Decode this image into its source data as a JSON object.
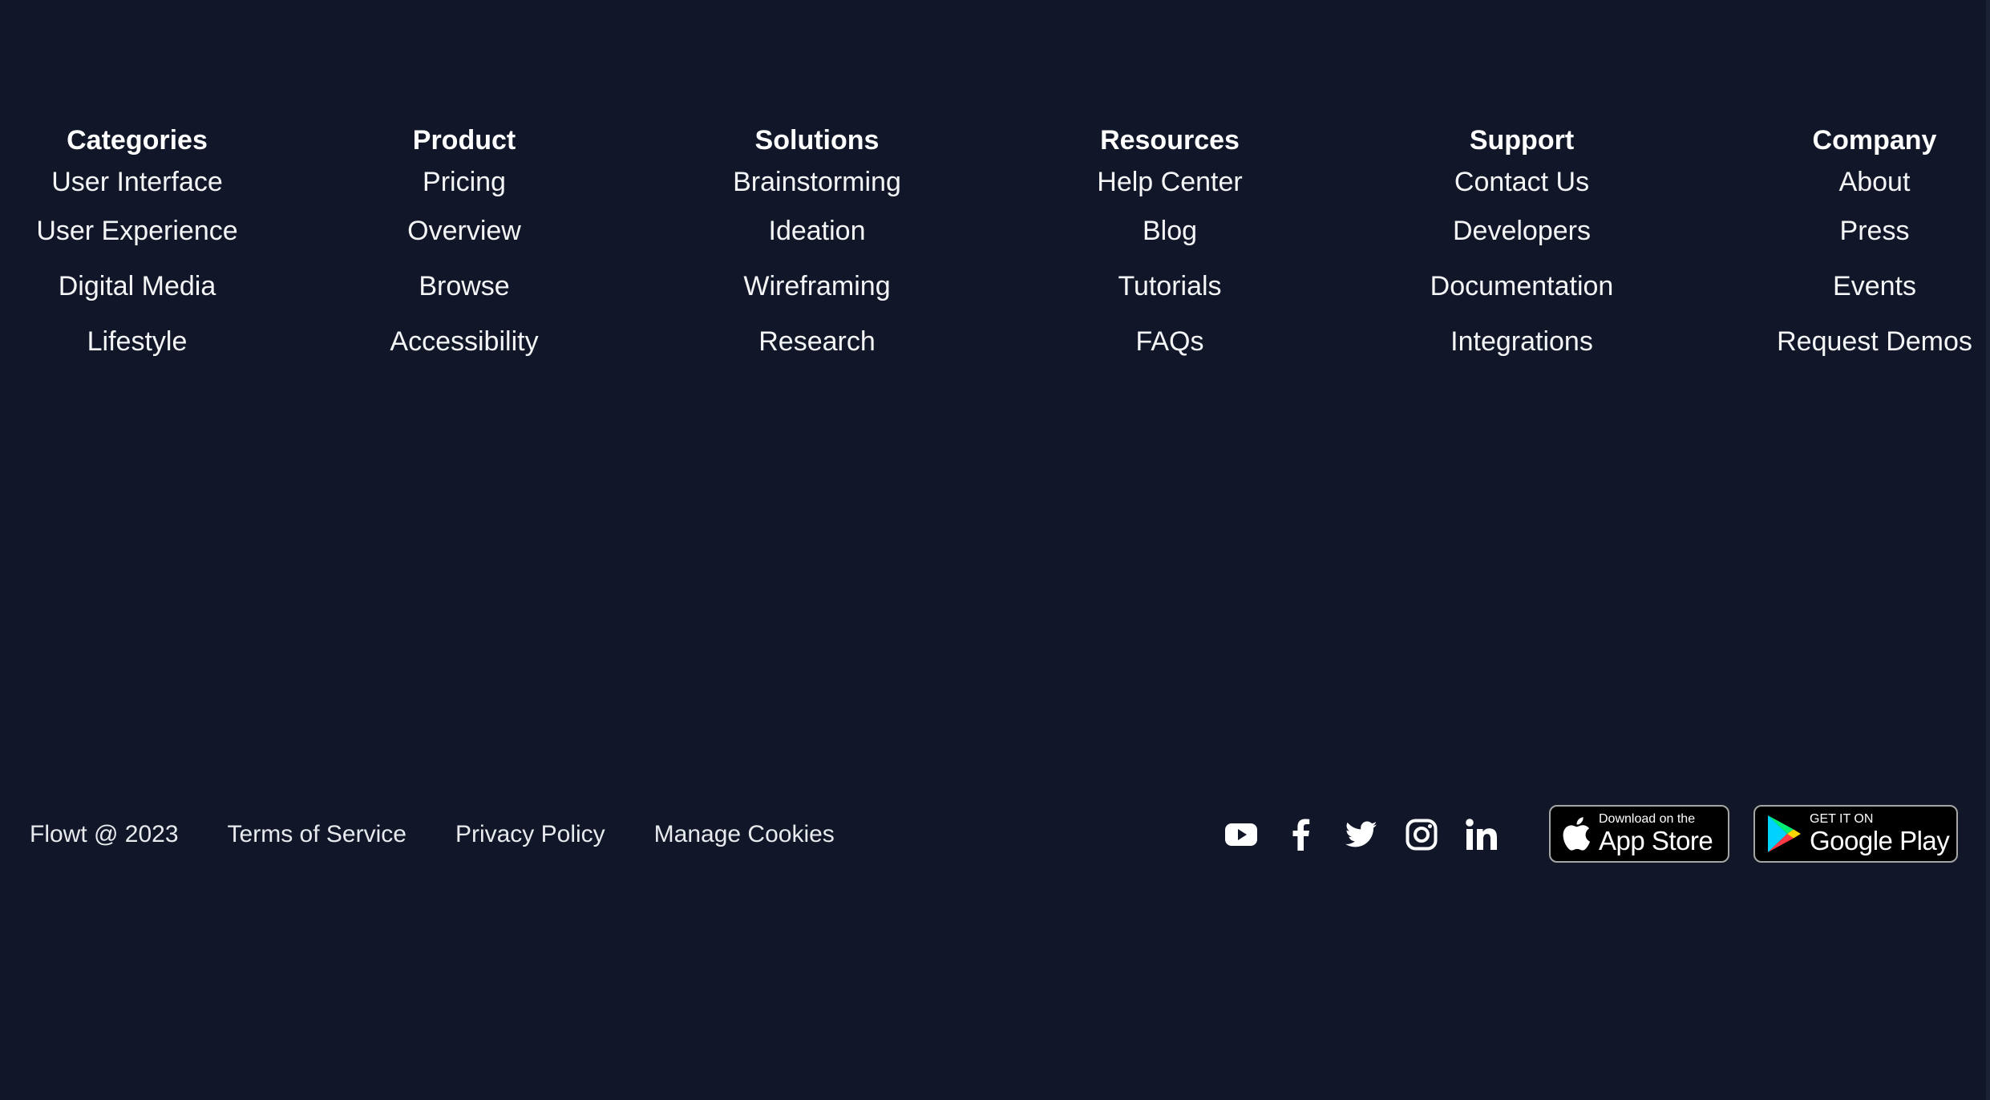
{
  "footer": {
    "columns": [
      {
        "heading": "Categories",
        "links": [
          "User Interface",
          "User Experience",
          "Digital Media",
          "Lifestyle"
        ]
      },
      {
        "heading": "Product",
        "links": [
          "Pricing",
          "Overview",
          "Browse",
          "Accessibility"
        ]
      },
      {
        "heading": "Solutions",
        "links": [
          "Brainstorming",
          "Ideation",
          "Wireframing",
          "Research"
        ]
      },
      {
        "heading": "Resources",
        "links": [
          "Help Center",
          "Blog",
          "Tutorials",
          "FAQs"
        ]
      },
      {
        "heading": "Support",
        "links": [
          "Contact Us",
          "Developers",
          "Documentation",
          "Integrations"
        ]
      },
      {
        "heading": "Company",
        "links": [
          "About",
          "Press",
          "Events",
          "Request Demos"
        ]
      }
    ]
  },
  "bottom": {
    "copyright": "Flowt @ 2023",
    "links": [
      "Terms of Service",
      "Privacy Policy",
      "Manage Cookies"
    ],
    "socials": [
      "youtube-icon",
      "facebook-icon",
      "twitter-icon",
      "instagram-icon",
      "linkedin-icon"
    ],
    "app_store": {
      "small": "Download on the",
      "large": "App Store"
    },
    "google_play": {
      "small": "GET IT ON",
      "large": "Google Play"
    }
  },
  "colors": {
    "background": "#111728",
    "text": "#ffffff",
    "badge_background": "#000000",
    "badge_border": "#a6a6a6"
  }
}
